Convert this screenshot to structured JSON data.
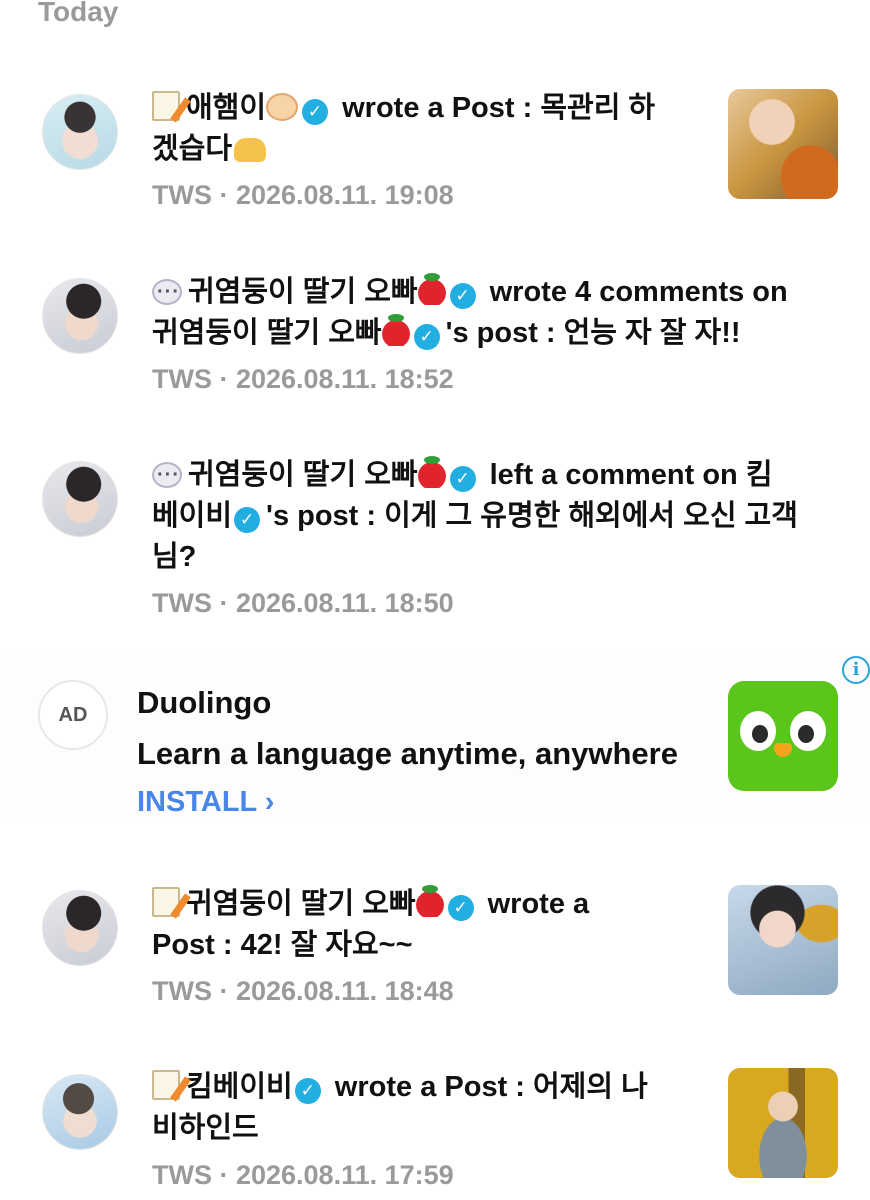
{
  "section_header": "Today",
  "notifications": [
    {
      "actor": "애햄이",
      "action": "wrote a Post :",
      "line1_rest": "목관리 하",
      "line2": "겠습다",
      "meta": "TWS · 2026.08.11. 19:08"
    },
    {
      "actor": "귀염둥이 딸기 오빠",
      "action": "wrote 4 comments on",
      "target": "귀염둥이 딸기 오빠",
      "post_suffix": "'s post : 언능 자 잘 자!!",
      "meta": "TWS · 2026.08.11. 18:52"
    },
    {
      "actor": "귀염둥이 딸기 오빠",
      "action": "left a comment on 킴",
      "target": "베이비",
      "post_suffix": "'s post : 이게 그 유명한 해외에서 오신 고객",
      "line3": "님?",
      "meta": "TWS · 2026.08.11. 18:50"
    },
    {
      "actor": "귀염둥이 딸기 오빠",
      "action": "wrote a",
      "line2": "Post : 42! 잘 자요~~",
      "meta": "TWS · 2026.08.11. 18:48"
    },
    {
      "actor": "킴베이비",
      "action": "wrote a Post : 어제의 나",
      "line2": "비하인드",
      "meta": "TWS · 2026.08.11. 17:59"
    }
  ],
  "ad": {
    "badge": "AD",
    "title": "Duolingo",
    "tagline": "Learn a language anytime, anywhere",
    "cta": "INSTALL ›",
    "info": "i"
  },
  "icons": {
    "verified": "✓"
  }
}
